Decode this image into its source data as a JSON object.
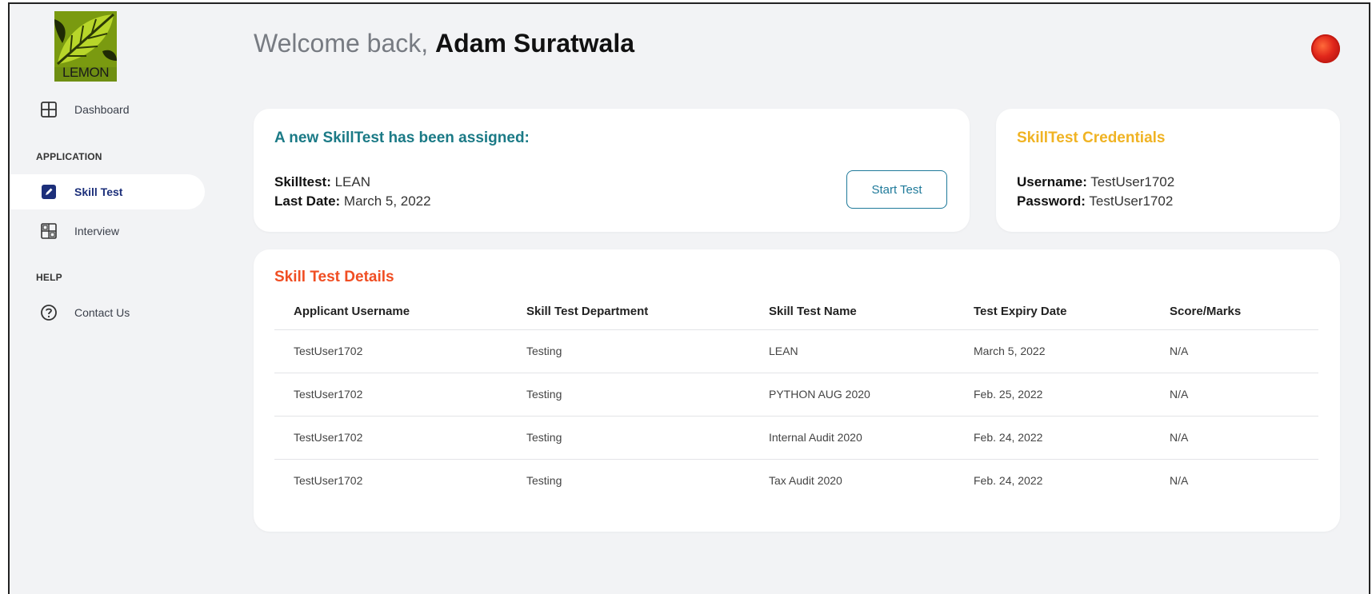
{
  "brand": {
    "logo_text": "LEMON"
  },
  "sidebar": {
    "dashboard_label": "Dashboard",
    "section_application": "APPLICATION",
    "skill_test_label": "Skill Test",
    "interview_label": "Interview",
    "section_help": "HELP",
    "contact_label": "Contact Us"
  },
  "header": {
    "welcome_prefix": "Welcome back,",
    "user_name": "Adam Suratwala"
  },
  "assignment": {
    "title": "A new SkillTest has been assigned:",
    "skilltest_key": "Skilltest:",
    "skilltest_value": "LEAN",
    "last_date_key": "Last Date:",
    "last_date_value": "March 5, 2022",
    "start_button": "Start Test"
  },
  "credentials": {
    "title": "SkillTest Credentials",
    "username_key": "Username:",
    "username_value": "TestUser1702",
    "password_key": "Password:",
    "password_value": "TestUser1702"
  },
  "details": {
    "title": "Skill Test Details",
    "columns": [
      "Applicant Username",
      "Skill Test Department",
      "Skill Test Name",
      "Test Expiry Date",
      "Score/Marks"
    ],
    "rows": [
      [
        "TestUser1702",
        "Testing",
        "LEAN",
        "March 5, 2022",
        "N/A"
      ],
      [
        "TestUser1702",
        "Testing",
        "PYTHON AUG 2020",
        "Feb. 25, 2022",
        "N/A"
      ],
      [
        "TestUser1702",
        "Testing",
        "Internal Audit 2020",
        "Feb. 24, 2022",
        "N/A"
      ],
      [
        "TestUser1702",
        "Testing",
        "Tax Audit 2020",
        "Feb. 24, 2022",
        "N/A"
      ]
    ]
  },
  "colors": {
    "teal": "#1b7a86",
    "amber": "#f0b323",
    "orange": "#f04e23",
    "nav_active": "#1c2f7a"
  }
}
